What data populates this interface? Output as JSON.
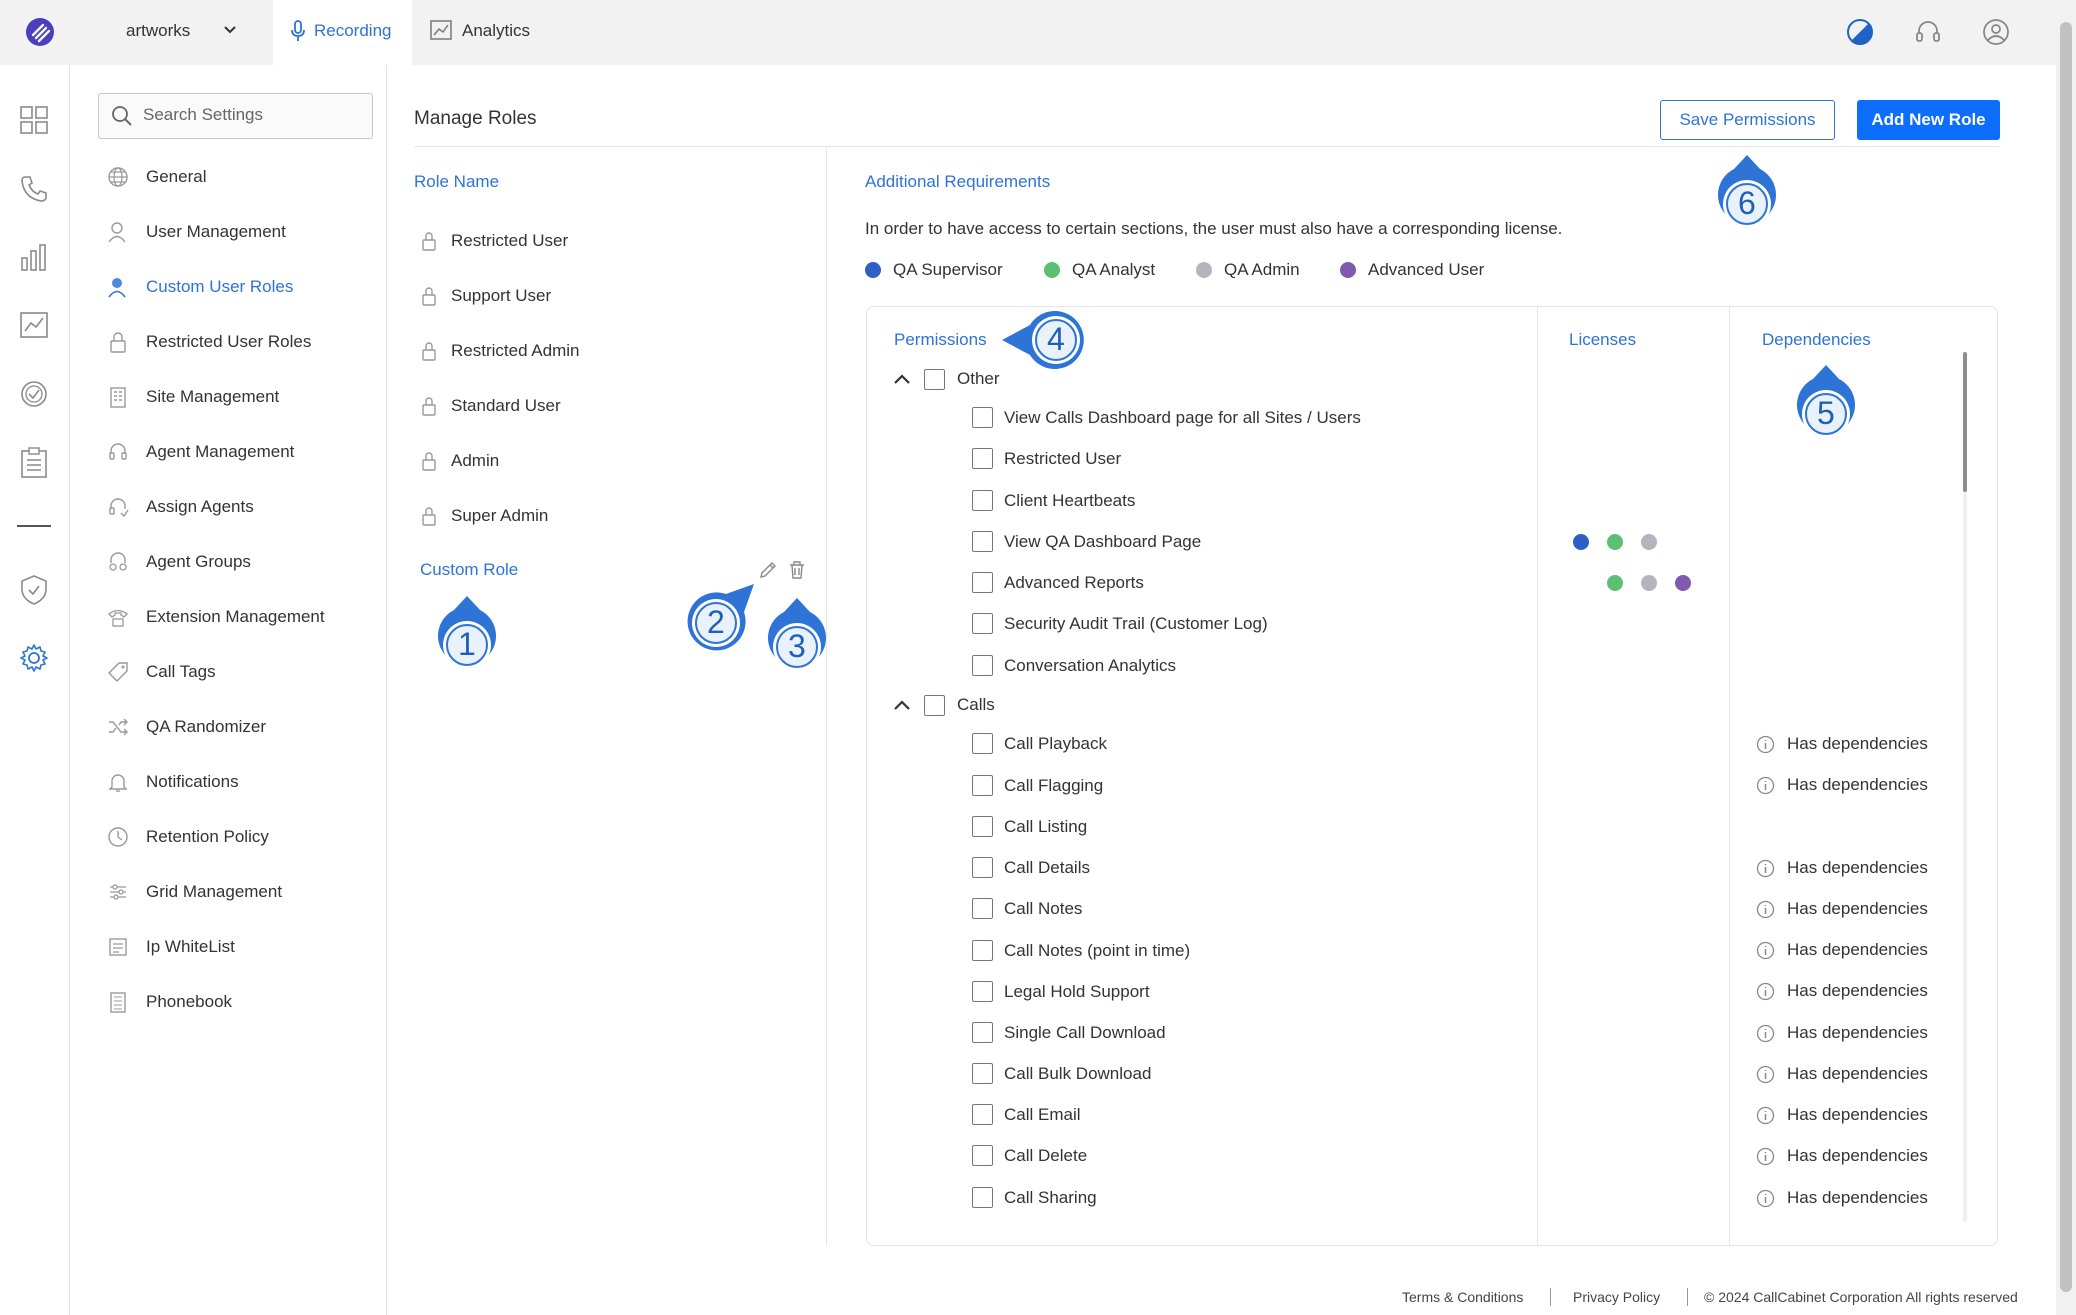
{
  "header": {
    "org_name": "artworks",
    "tabs": [
      {
        "label": "Recording",
        "icon": "microphone-icon",
        "active": true
      },
      {
        "label": "Analytics",
        "icon": "analytics-chart-icon",
        "active": false
      }
    ]
  },
  "colors": {
    "accent": "#2e73d6",
    "primary_button": "#0d6efd",
    "qa_supervisor": "#2d5fc4",
    "qa_analyst": "#5cc073",
    "qa_admin": "#b2b6bc",
    "advanced_user": "#7e5bb0"
  },
  "settings": {
    "search_placeholder": "Search Settings",
    "items": [
      {
        "label": "General",
        "icon": "globe-icon"
      },
      {
        "label": "User Management",
        "icon": "user-icon"
      },
      {
        "label": "Custom User Roles",
        "icon": "user-role-icon",
        "active": true
      },
      {
        "label": "Restricted User Roles",
        "icon": "lock-icon"
      },
      {
        "label": "Site Management",
        "icon": "building-icon"
      },
      {
        "label": "Agent Management",
        "icon": "headset-icon"
      },
      {
        "label": "Assign Agents",
        "icon": "assign-agent-icon"
      },
      {
        "label": "Agent Groups",
        "icon": "agent-group-icon"
      },
      {
        "label": "Extension Management",
        "icon": "phone-extension-icon"
      },
      {
        "label": "Call Tags",
        "icon": "tag-icon"
      },
      {
        "label": "QA Randomizer",
        "icon": "shuffle-icon"
      },
      {
        "label": "Notifications",
        "icon": "bell-icon"
      },
      {
        "label": "Retention Policy",
        "icon": "clock-icon"
      },
      {
        "label": "Grid Management",
        "icon": "sliders-icon"
      },
      {
        "label": "Ip WhiteList",
        "icon": "ip-list-icon"
      },
      {
        "label": "Phonebook",
        "icon": "phonebook-icon"
      }
    ]
  },
  "manage_roles": {
    "title": "Manage Roles",
    "save_label": "Save Permissions",
    "add_label": "Add New Role",
    "role_name_header": "Role Name",
    "roles": [
      "Restricted User",
      "Support User",
      "Restricted Admin",
      "Standard User",
      "Admin",
      "Super Admin"
    ],
    "custom_role": "Custom Role"
  },
  "requirements": {
    "title": "Additional Requirements",
    "description": "In order to have access to certain sections, the user must also have a corresponding license.",
    "legend": [
      "QA Supervisor",
      "QA Analyst",
      "QA Admin",
      "Advanced User"
    ]
  },
  "permissions": {
    "headers": {
      "permissions": "Permissions",
      "licenses": "Licenses",
      "dependencies": "Dependencies"
    },
    "dependency_label": "Has dependencies",
    "groups": [
      {
        "label": "Other",
        "items": [
          "View Calls Dashboard page for all Sites / Users",
          "Restricted User",
          "Client Heartbeats",
          "View QA Dashboard Page",
          "Advanced Reports",
          "Security Audit Trail (Customer Log)",
          "Conversation Analytics"
        ]
      },
      {
        "label": "Calls",
        "items": [
          "Call Playback",
          "Call Flagging",
          "Call Listing",
          "Call Details",
          "Call Notes",
          "Call Notes (point in time)",
          "Legal Hold Support",
          "Single Call Download",
          "Call Bulk Download",
          "Call Email",
          "Call Delete",
          "Call Sharing"
        ]
      }
    ]
  },
  "markers": [
    "1",
    "2",
    "3",
    "4",
    "5",
    "6"
  ],
  "footer": {
    "terms": "Terms & Conditions",
    "privacy": "Privacy Policy",
    "copyright": "© 2024 CallCabinet Corporation All rights reserved"
  }
}
